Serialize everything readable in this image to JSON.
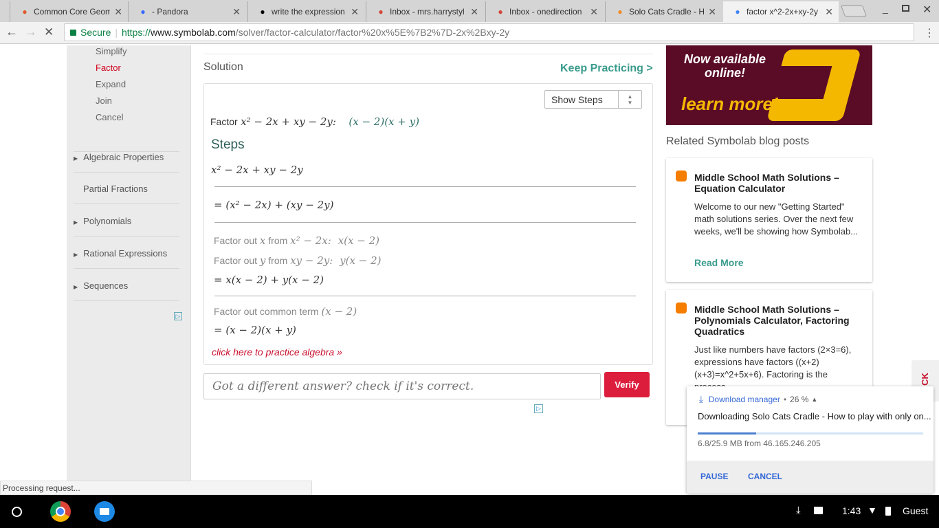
{
  "browser": {
    "tabs": [
      {
        "label": "Common Core Geom",
        "icon": "x-logo-icon",
        "color": "#e0592a"
      },
      {
        "label": "- Pandora",
        "icon": "pandora-icon",
        "color": "#3668ff"
      },
      {
        "label": "write the expression",
        "icon": "brainly-icon",
        "color": "#000"
      },
      {
        "label": "Inbox - mrs.harrystyl",
        "icon": "gmail-icon",
        "color": "#d44638"
      },
      {
        "label": "Inbox - onedirection",
        "icon": "gmail-icon",
        "color": "#d44638"
      },
      {
        "label": "Solo Cats Cradle - H",
        "icon": "soundwave-icon",
        "color": "#f08a24"
      },
      {
        "label": "factor x^2-2x+xy-2y -",
        "icon": "loading-icon",
        "color": "#4285f4"
      }
    ],
    "secure": "Secure",
    "url_scheme": "https://",
    "url_host": "www.symbolab.com",
    "url_path": "/solver/factor-calculator/factor%20x%5E%7B2%7D-2x%2Bxy-2y"
  },
  "sidebar": {
    "links": [
      "Simplify",
      "Factor",
      "Expand",
      "Join",
      "Cancel"
    ],
    "sections": [
      "Algebraic Properties",
      "Partial Fractions",
      "Polynomials",
      "Rational Expressions",
      "Sequences"
    ]
  },
  "solution": {
    "title": "Solution",
    "keep_practicing": "Keep Practicing >",
    "show_steps": "Show Steps",
    "factor_label": "Factor",
    "problem": "x² − 2x + xy − 2y:",
    "answer": "(x − 2)(x + y)",
    "steps_title": "Steps",
    "step0": "x² − 2x + xy − 2y",
    "step1": "= (x² − 2x) + (xy − 2y)",
    "step2a_label": "Factor out",
    "step2a_var": "x",
    "step2a_from": "from",
    "step2a_expr": "x² − 2x:",
    "step2a_res": "x(x − 2)",
    "step2b_label": "Factor out",
    "step2b_var": "y",
    "step2b_from": "from",
    "step2b_expr": "xy − 2y:",
    "step2b_res": "y(x − 2)",
    "step2c": "= x(x − 2) + y(x − 2)",
    "step3_label": "Factor out common term",
    "step3_expr": "(x − 2)",
    "step3_res": "= (x − 2)(x + y)",
    "practice_link": "click here to practice algebra »"
  },
  "check": {
    "placeholder": "Got a different answer? check if it's correct.",
    "verify": "Verify"
  },
  "ad": {
    "line1": "Now available",
    "line2": "online!",
    "line3": "learn more!"
  },
  "blog": {
    "heading": "Related Symbolab blog posts",
    "posts": [
      {
        "title": "Middle School Math Solutions – Equation Calculator",
        "body": "Welcome to our new \"Getting Started\" math solutions series. Over the next few weeks, we'll be showing how Symbolab...",
        "more": "Read More"
      },
      {
        "title": "Middle School Math Solutions – Polynomials Calculator, Factoring Quadratics",
        "body": "Just like numbers have factors (2×3=6), expressions have factors ((x+2)(x+3)=x^2+5x+6). Factoring is the process"
      }
    ]
  },
  "side_tab": "CK",
  "download": {
    "title": "Download manager",
    "percent_text": "26 %",
    "progress": 0.26,
    "file": "Downloading Solo Cats Cradle - How to play with only on...",
    "detail": "6.8/25.9 MB from 46.165.246.205",
    "pause": "PAUSE",
    "cancel": "CANCEL"
  },
  "status": "Processing request...",
  "taskbar": {
    "time": "1:43",
    "user": "Guest"
  }
}
